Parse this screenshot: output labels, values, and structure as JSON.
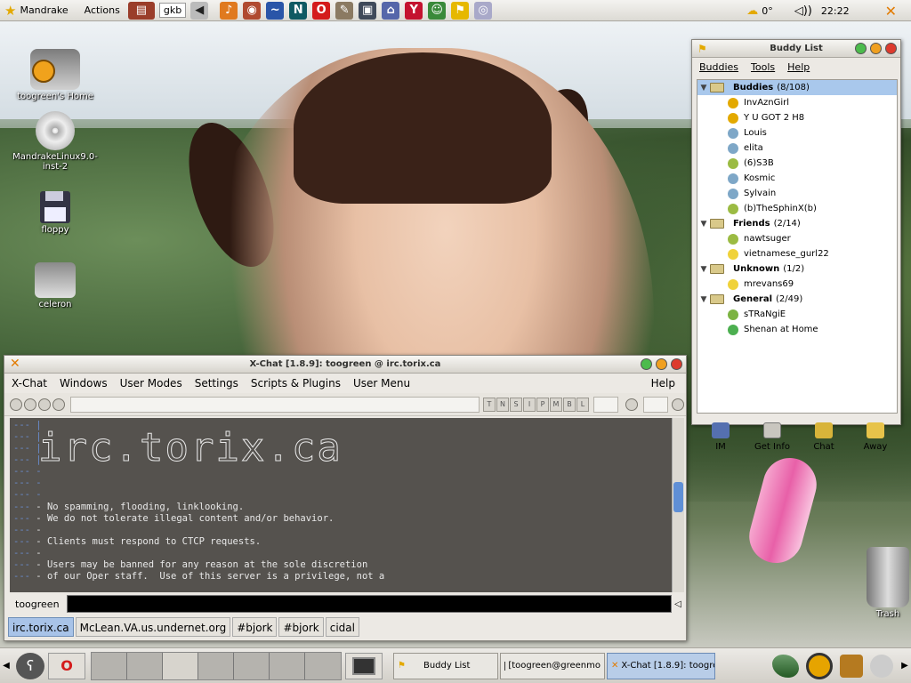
{
  "top_panel": {
    "menu_label": "Mandrake",
    "actions_label": "Actions",
    "keyboard_label": "gkb",
    "weather": "0°",
    "clock": "22:22"
  },
  "desktop_icons": [
    {
      "label": "toogreen's Home"
    },
    {
      "label": "MandrakeLinux9.0-inst-2"
    },
    {
      "label": "floppy"
    },
    {
      "label": "celeron"
    },
    {
      "label": "Trash"
    }
  ],
  "buddy_list": {
    "title": "Buddy List",
    "menu": [
      "Buddies",
      "Tools",
      "Help"
    ],
    "rows": [
      {
        "type": "group",
        "name": "Buddies",
        "count": "(8/108)"
      },
      {
        "type": "buddy",
        "name": "InvAznGirl"
      },
      {
        "type": "buddy",
        "name": "Y U GOT 2 H8"
      },
      {
        "type": "buddy",
        "name": "Louis"
      },
      {
        "type": "buddy",
        "name": "elita"
      },
      {
        "type": "buddy",
        "name": "(6)S3B"
      },
      {
        "type": "buddy",
        "name": "Kosmic"
      },
      {
        "type": "buddy",
        "name": "Sylvain"
      },
      {
        "type": "buddy",
        "name": "(b)TheSphinX(b)"
      },
      {
        "type": "group",
        "name": "Friends",
        "count": "(2/14)"
      },
      {
        "type": "buddy",
        "name": "nawtsuger"
      },
      {
        "type": "buddy",
        "name": "vietnamese_gurl22"
      },
      {
        "type": "group",
        "name": "Unknown",
        "count": "(1/2)"
      },
      {
        "type": "buddy",
        "name": "mrevans69"
      },
      {
        "type": "group",
        "name": "General",
        "count": "(2/49)"
      },
      {
        "type": "buddy",
        "name": "sTRaNgiE"
      },
      {
        "type": "buddy",
        "name": "Shenan at Home"
      }
    ],
    "buttons": [
      "IM",
      "Get Info",
      "Chat",
      "Away"
    ]
  },
  "xchat": {
    "title": "X-Chat [1.8.9]: toogreen @ irc.torix.ca",
    "menu": [
      "X-Chat",
      "Windows",
      "User Modes",
      "Settings",
      "Scripts & Plugins",
      "User Menu"
    ],
    "help_label": "Help",
    "mode_buttons": [
      "T",
      "N",
      "S",
      "I",
      "P",
      "M",
      "B",
      "L"
    ],
    "lines": [
      "- No spamming, flooding, linklooking.",
      "- We do not tolerate illegal content and/or behavior.",
      "-",
      "- Clients must respond to CTCP requests.",
      "-",
      "- Users may be banned for any reason at the sole discretion",
      "- of our Oper staff.  Use of this server is a privilege, not a"
    ],
    "nick": "toogreen",
    "tabs": [
      "irc.torix.ca",
      "McLean.VA.us.undernet.org",
      "#bjork",
      "#bjork",
      "cidal"
    ]
  },
  "taskbar": {
    "tasks": [
      "Buddy List",
      "[toogreen@greenmo",
      "X-Chat [1.8.9]: toogre"
    ]
  }
}
